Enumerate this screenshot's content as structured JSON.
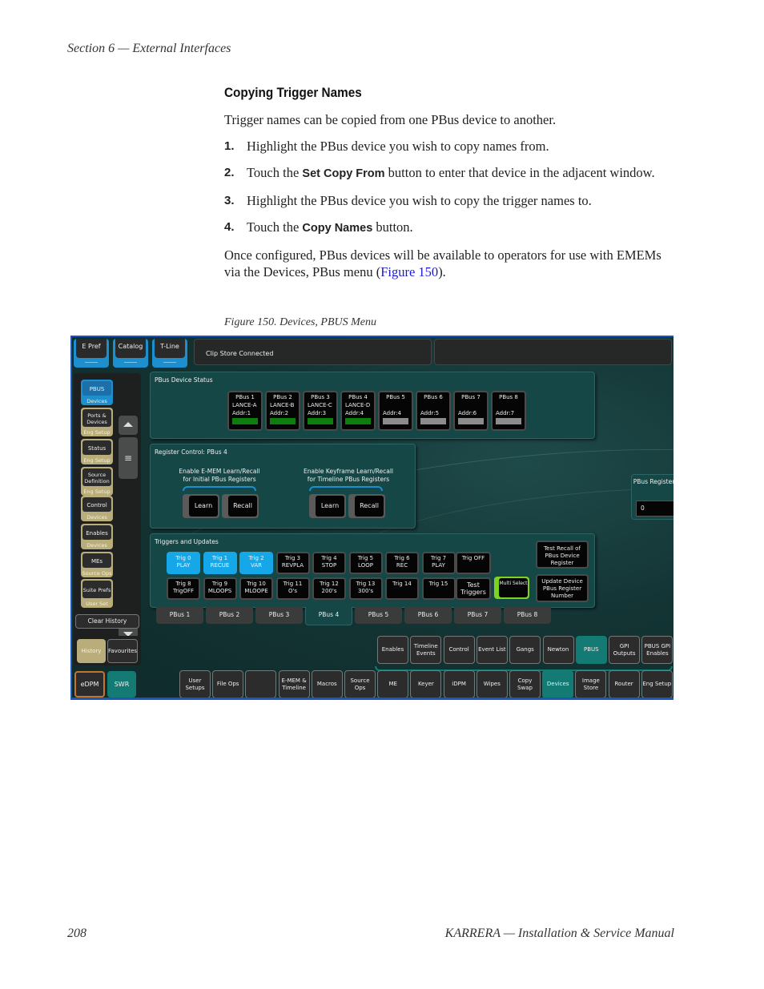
{
  "page": {
    "header": "Section 6 — External Interfaces",
    "footer_page": "208",
    "footer_title": "KARRERA  —  Installation & Service Manual"
  },
  "content": {
    "heading": "Copying Trigger Names",
    "intro": "Trigger names can be copied from one PBus device to another.",
    "steps": [
      {
        "num": "1.",
        "pre": "Highlight the PBus device you wish to copy names from.",
        "kw": "",
        "post": ""
      },
      {
        "num": "2.",
        "pre": "Touch the ",
        "kw": "Set Copy From",
        "post": " button to enter that device in the adjacent window."
      },
      {
        "num": "3.",
        "pre": "Highlight the PBus device you wish to copy the trigger names to.",
        "kw": "",
        "post": ""
      },
      {
        "num": "4.",
        "pre": "Touch the ",
        "kw": "Copy Names",
        "post": " button."
      }
    ],
    "outro_pre": "Once configured, PBus devices will be available to operators for use with EMEMs via the Devices, PBus menu (",
    "outro_link": "Figure 150",
    "outro_post": ").",
    "caption": "Figure 150.  Devices, PBUS Menu"
  },
  "ui": {
    "top_buttons": [
      "E Pref",
      "Catalog",
      "T-Line"
    ],
    "status_text": "Clip Store Connected",
    "side_buttons": [
      {
        "top": "PBUS",
        "bottom": "Devices",
        "active": true
      },
      {
        "top": "Ports & Devices",
        "bottom": "Eng  Setup",
        "active": false
      },
      {
        "top": "Status",
        "bottom": "Eng  Setup",
        "active": false
      },
      {
        "top": "Source Definition",
        "bottom": "Eng  Setup",
        "active": false
      },
      {
        "top": "Control",
        "bottom": "Devices",
        "active": false
      },
      {
        "top": "Enables",
        "bottom": "Devices",
        "active": false
      },
      {
        "top": "MEs",
        "bottom": "Source Ops",
        "active": false
      },
      {
        "top": "Suite Prefs",
        "bottom": "User Set",
        "active": false
      }
    ],
    "clear_history": "Clear History",
    "history": "History",
    "favourites": "Favourites",
    "edpm": "eDPM",
    "swr": "SWR",
    "device_status": {
      "title": "PBus Device Status",
      "devices": [
        {
          "name": "PBus 1",
          "label": "LANCE-A",
          "addr": "Addr:1",
          "online": true
        },
        {
          "name": "PBus 2",
          "label": "LANCE-B",
          "addr": "Addr:2",
          "online": true
        },
        {
          "name": "PBus 3",
          "label": "LANCE-C",
          "addr": "Addr:3",
          "online": true
        },
        {
          "name": "PBus 4",
          "label": "LANCE-D",
          "addr": "Addr:4",
          "online": true
        },
        {
          "name": "PBus 5",
          "label": "",
          "addr": "Addr:4",
          "online": false
        },
        {
          "name": "PBus 6",
          "label": "",
          "addr": "Addr:5",
          "online": false
        },
        {
          "name": "PBus 7",
          "label": "",
          "addr": "Addr:6",
          "online": false
        },
        {
          "name": "PBus 8",
          "label": "",
          "addr": "Addr:7",
          "online": false
        }
      ]
    },
    "register_control": {
      "title": "Register Control: PBus 4",
      "group1_label": "Enable E-MEM Learn/Recall\nfor Initial PBus Registers",
      "group2_label": "Enable Keyframe Learn/Recall\nfor Timeline PBus Registers",
      "learn": "Learn",
      "recall": "Recall"
    },
    "pbus_register": {
      "label": "PBus Register",
      "value": "0"
    },
    "triggers": {
      "title": "Triggers and Updates",
      "row1": [
        {
          "num": "Trig 0",
          "name": "PLAY",
          "on": true
        },
        {
          "num": "Trig 1",
          "name": "RECUE",
          "on": true
        },
        {
          "num": "Trig 2",
          "name": "VAR",
          "on": true
        },
        {
          "num": "Trig 3",
          "name": "REVPLA",
          "on": false
        },
        {
          "num": "Trig 4",
          "name": "STOP",
          "on": false
        },
        {
          "num": "Trig 5",
          "name": "LOOP",
          "on": false
        },
        {
          "num": "Trig 6",
          "name": "REC",
          "on": false
        },
        {
          "num": "Trig 7",
          "name": "PLAY",
          "on": false
        }
      ],
      "row2": [
        {
          "num": "Trig 8",
          "name": "TrigOFF",
          "on": false
        },
        {
          "num": "Trig 9",
          "name": "MLOOPS",
          "on": false
        },
        {
          "num": "Trig 10",
          "name": "MLOOPE",
          "on": false
        },
        {
          "num": "Trig 11",
          "name": "O's",
          "on": false
        },
        {
          "num": "Trig 12",
          "name": "200's",
          "on": false
        },
        {
          "num": "Trig 13",
          "name": "300's",
          "on": false
        },
        {
          "num": "Trig 14",
          "name": "",
          "on": false
        },
        {
          "num": "Trig 15",
          "name": "",
          "on": false
        }
      ],
      "trig_off": "Trig OFF",
      "test_triggers": "Test Triggers",
      "multi_select": "Multi Select",
      "test_recall": "Test Recall of PBus Device Register",
      "update_device": "Update Device PBus Register Number"
    },
    "pbus_tabs": [
      "PBus 1",
      "PBus 2",
      "PBus 3",
      "PBus 4",
      "PBus 5",
      "PBus 6",
      "PBus 7",
      "PBus 8"
    ],
    "active_tab": "PBus 4",
    "submenu": [
      "Enables",
      "Timeline Events",
      "Control",
      "Event List",
      "Gangs",
      "Newton",
      "PBUS",
      "GPI Outputs",
      "PBUS GPI Enables"
    ],
    "submenu_active": "PBUS",
    "mainmenu": [
      "User Setups",
      "File Ops",
      "",
      "E-MEM & Timeline",
      "Macros",
      "Source Ops",
      "ME",
      "Keyer",
      "iDPM",
      "Wipes",
      "Copy Swap",
      "Devices",
      "Image Store",
      "Router",
      "Eng Setup"
    ],
    "mainmenu_active": "Devices"
  }
}
